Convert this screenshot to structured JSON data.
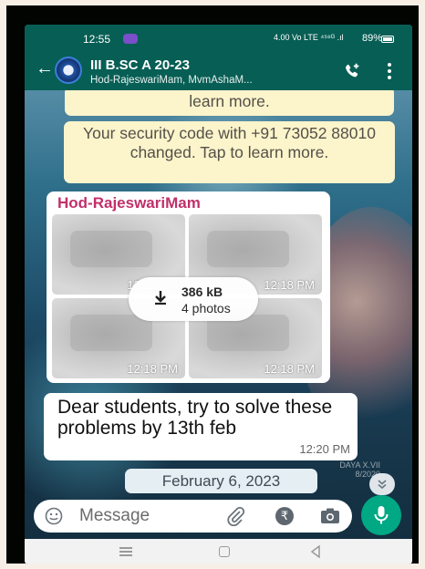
{
  "status_bar": {
    "time": "12:55",
    "network": "4.00 Vo LTE ⁴⁵⁶ᴳ .ıl",
    "battery": "89%"
  },
  "header": {
    "title": "III B.SC A 20-23",
    "subtitle": "Hod-RajeswariMam, MvmAshaM..."
  },
  "system_messages": [
    "learn more.",
    "Your security code with +91 73052 88010 changed. Tap to learn more."
  ],
  "photo_message": {
    "sender": "Hod-RajeswariMam",
    "photo_times": [
      "12:18 PM",
      "12:18 PM",
      "12:18 PM",
      "12:18 PM"
    ],
    "download_size": "386 kB",
    "photo_count": "4 photos"
  },
  "text_message": {
    "text": "Dear students, try to solve these problems by 13th feb",
    "time": "12:20 PM"
  },
  "date_chip": "February 6, 2023",
  "wallpaper_watermark": {
    "line1": "DAYA X.VII",
    "line2": "8/2020"
  },
  "input": {
    "placeholder": "Message"
  },
  "icons": {
    "back": "arrow-left-icon",
    "call": "add-call-icon",
    "menu": "more-vert-icon",
    "emoji": "emoji-icon",
    "attach": "paperclip-icon",
    "payment": "rupee-icon",
    "camera": "camera-icon",
    "mic": "mic-icon",
    "scroll": "double-chevron-down-icon"
  },
  "colors": {
    "header": "#075e54",
    "sender": "#c0306a",
    "system_bubble": "#fcf4cb",
    "mic_button": "#00a884"
  }
}
